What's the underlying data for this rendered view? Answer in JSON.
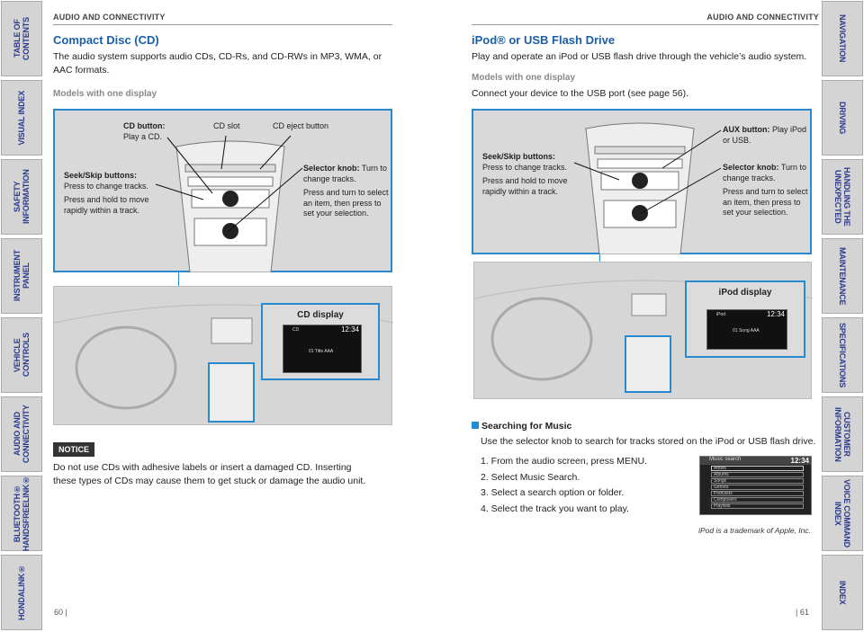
{
  "left_tabs": [
    "TABLE OF CONTENTS",
    "VISUAL INDEX",
    "SAFETY INFORMATION",
    "INSTRUMENT PANEL",
    "VEHICLE CONTROLS",
    "AUDIO AND CONNECTIVITY",
    "BLUETOOTH® HANDSFREELINK®",
    "HONDALINK®"
  ],
  "right_tabs": [
    "NAVIGATION",
    "DRIVING",
    "HANDLING THE UNEXPECTED",
    "MAINTENANCE",
    "SPECIFICATIONS",
    "CUSTOMER INFORMATION",
    "VOICE COMMAND INDEX",
    "INDEX"
  ],
  "left_page": {
    "header": "AUDIO AND CONNECTIVITY",
    "title": "Compact Disc (CD)",
    "intro": "The audio system supports audio CDs, CD-Rs, and CD-RWs in MP3, WMA, or AAC formats.",
    "subheading": "Models with one display",
    "callouts": {
      "cd_button_b": "CD button:",
      "cd_button": "Play a CD.",
      "cd_slot": "CD slot",
      "cd_eject": "CD eject button",
      "seek_b": "Seek/Skip buttons:",
      "seek": " Press to change tracks.",
      "seek_hold": "Press and hold to move rapidly within a track.",
      "knob_b": "Selector knob:",
      "knob": " Turn to change tracks.",
      "knob_press": "Press and turn to select an item, then press to set your selection."
    },
    "display_label": "CD display",
    "screen": {
      "source": "CD",
      "time": "12:34",
      "track": "01 Title AAA"
    },
    "notice_badge": "NOTICE",
    "notice": "Do not use CDs with adhesive labels or insert a damaged CD. Inserting these types of CDs may cause them to get stuck or damage the audio unit.",
    "page_number": "60  |"
  },
  "right_page": {
    "header": "AUDIO AND CONNECTIVITY",
    "title": "iPod® or USB Flash Drive",
    "intro": "Play and operate an iPod or USB flash drive through the vehicle’s audio system.",
    "subheading": "Models with one display",
    "connect": "Connect your device to the USB port (see page 56).",
    "callouts": {
      "aux_b": "AUX button:",
      "aux": " Play iPod or USB.",
      "seek_b": "Seek/Skip buttons:",
      "seek": " Press to change tracks.",
      "seek_hold": "Press and hold to move rapidly within a track.",
      "knob_b": "Selector knob:",
      "knob": " Turn to change tracks.",
      "knob_press": "Press and turn to select an item, then press to set your selection."
    },
    "display_label": "iPod display",
    "screen": {
      "source": "iPod",
      "time": "12:34",
      "track": "01 Song AAA"
    },
    "section_heading": "Searching for Music",
    "section_intro": "Use the selector knob to search for tracks stored on the iPod or USB flash drive.",
    "steps": [
      "1.  From the audio screen, press MENU.",
      "2.  Select Music Search.",
      "3.  Select a search option or folder.",
      "4.  Select the track you want to play."
    ],
    "music_search": {
      "title": "Music search",
      "time": "12:34",
      "items": [
        "Artists",
        "Albums",
        "Songs",
        "Genres",
        "Podcasts",
        "Composers",
        "Playlists"
      ]
    },
    "trademark": "iPod is a trademark of Apple, Inc.",
    "page_number": "|  61"
  },
  "colors": {
    "accent": "#1b5ea8",
    "callout_border": "#2a8ad0",
    "tab_text": "#2a3a8c"
  }
}
